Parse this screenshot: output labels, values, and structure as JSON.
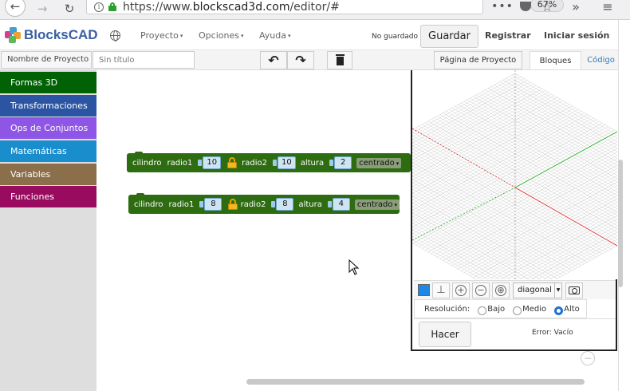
{
  "browser": {
    "url_prefix": "https://www.",
    "url_host": "blockscad3d.com",
    "url_path": "/editor/#",
    "zoom": "67%"
  },
  "header": {
    "logo_text": "BlocksCAD",
    "menus": {
      "proyecto": "Proyecto",
      "opciones": "Opciones",
      "ayuda": "Ayuda"
    },
    "save_status": "No guardado",
    "save_button": "Guardar",
    "register": "Registrar",
    "login": "Iniciar sesión"
  },
  "toolbar": {
    "project_name_label": "Nombre de Proyecto",
    "project_name_placeholder": "Sin título",
    "project_page_button": "Página de Proyecto",
    "tab_blocks": "Bloques",
    "tab_code": "Código"
  },
  "categories": [
    "Formas 3D",
    "Transformaciones",
    "Ops de Conjuntos",
    "Matemáticas",
    "Variables",
    "Funciones"
  ],
  "blocks": [
    {
      "type": "cilindro",
      "radio1_label": "radio1",
      "radio1": "10",
      "radio2_label": "radio2",
      "radio2": "10",
      "altura_label": "altura",
      "altura": "2",
      "mode": "centrado"
    },
    {
      "type": "cilindro",
      "radio1_label": "radio1",
      "radio1": "8",
      "radio2_label": "radio2",
      "radio2": "8",
      "altura_label": "altura",
      "altura": "4",
      "mode": "centrado"
    }
  ],
  "viewer": {
    "view_mode": "diagonal",
    "resolution_label": "Resolución:",
    "resolutions": [
      "Bajo",
      "Medio",
      "Alto"
    ],
    "selected_resolution": "Alto",
    "render_button": "Hacer",
    "error_text": "Error: Vacío",
    "colors": {
      "swatch": "#1e88e5",
      "x_axis": "#e02020",
      "y_axis": "#20b020",
      "grid": "#cccccc"
    }
  }
}
